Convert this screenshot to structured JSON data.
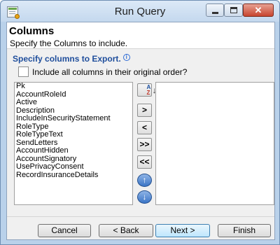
{
  "window": {
    "title": "Run Query"
  },
  "caption_buttons": {
    "minimize": "",
    "maximize": "",
    "close": "✕"
  },
  "header": {
    "heading": "Columns",
    "subheading": "Specify the Columns to include."
  },
  "section": {
    "title": "Specify columns to Export.",
    "info_icon": "i"
  },
  "include_all": {
    "label": "Include all columns in their original order?",
    "checked": false
  },
  "available_columns": [
    "Pk",
    "AccountRoleId",
    "Active",
    "Description",
    "IncludeInSecurityStatement",
    "RoleType",
    "RoleTypeText",
    "SendLetters",
    "AccountHidden",
    "AccountSignatory",
    "UsePrivacyConsent",
    "RecordInsuranceDetails"
  ],
  "selected_columns": [],
  "shuttle_buttons": {
    "sort": "sort-az-icon",
    "add": ">",
    "remove": "<",
    "add_all": ">>",
    "remove_all": "<<",
    "move_up": "↑",
    "move_down": "↓"
  },
  "footer_buttons": {
    "cancel": "Cancel",
    "back": "< Back",
    "next": "Next >",
    "finish": "Finish"
  }
}
